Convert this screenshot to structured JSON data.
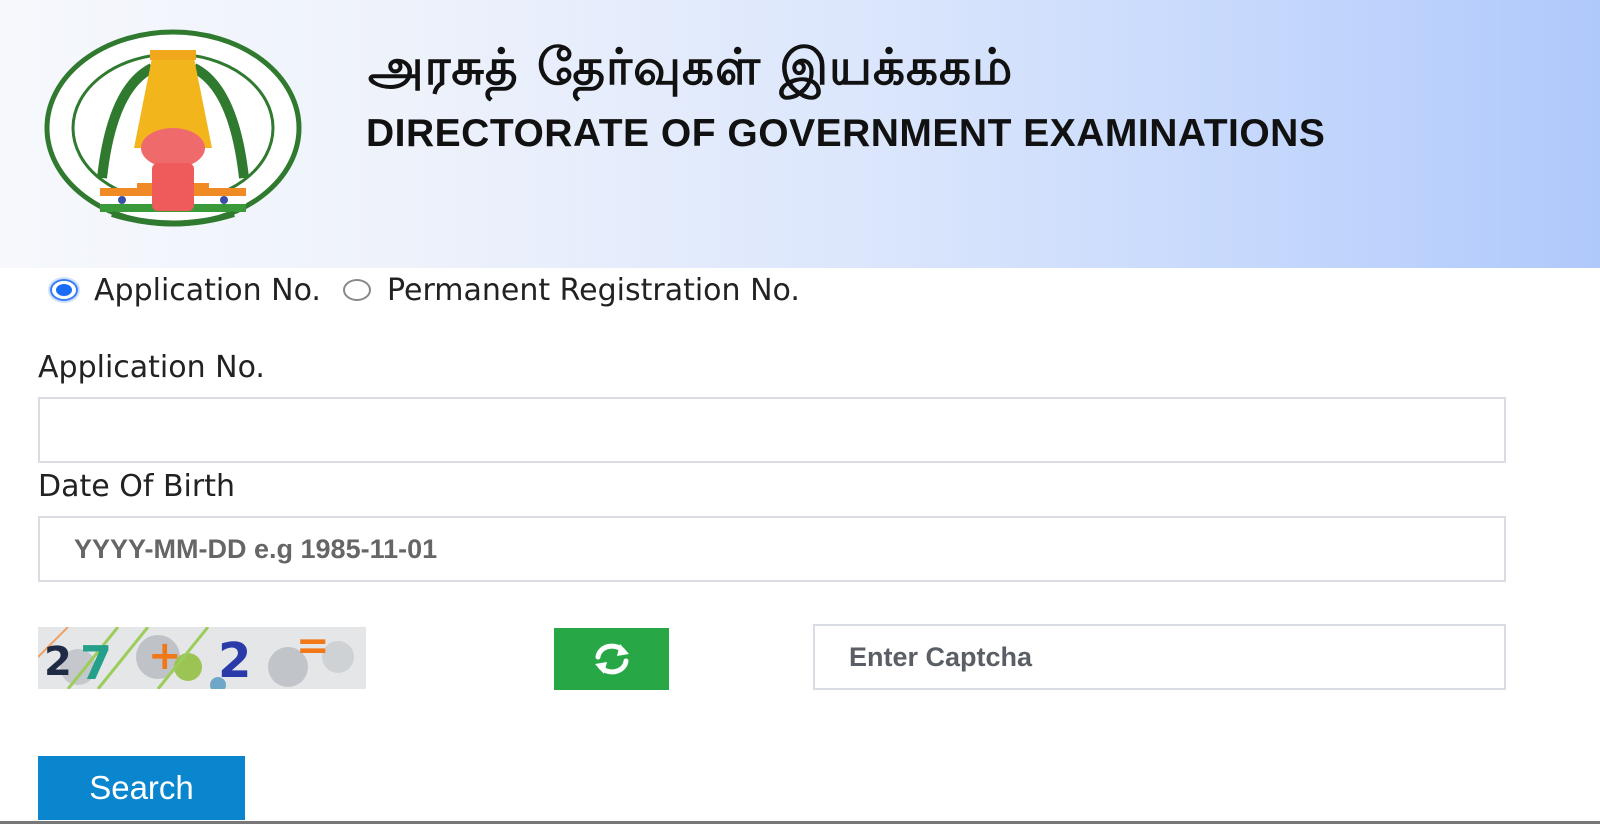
{
  "header": {
    "title_tamil": "அரசுத் தேர்வுகள் இயக்ககம்",
    "title_english": "DIRECTORATE OF GOVERNMENT EXAMINATIONS",
    "emblem_icon": "tamil-nadu-emblem-icon",
    "colors": {
      "gradient_start": "#f6f8fc",
      "gradient_end": "#b0c9fb"
    }
  },
  "search_type": {
    "options": [
      {
        "label": "Application No.",
        "selected": true
      },
      {
        "label": "Permanent Registration No.",
        "selected": false
      }
    ]
  },
  "form": {
    "application_no": {
      "label": "Application No.",
      "value": "",
      "placeholder": ""
    },
    "dob": {
      "label": "Date Of Birth",
      "value": "",
      "placeholder": "YYYY-MM-DD e.g 1985-11-01"
    },
    "captcha": {
      "image_text": "27+2=",
      "refresh_icon": "refresh-icon",
      "input_placeholder": "Enter Captcha",
      "input_value": ""
    },
    "search_label": "Search"
  },
  "colors": {
    "radio_selected": "#1a6cf5",
    "refresh_button": "#27a745",
    "search_button": "#0a86cf"
  }
}
